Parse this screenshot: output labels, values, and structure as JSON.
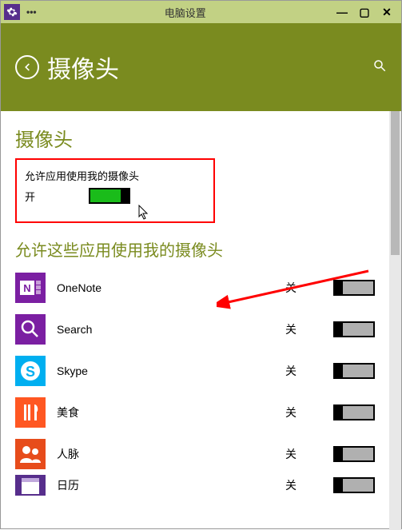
{
  "titlebar": {
    "title": "电脑设置"
  },
  "header": {
    "title": "摄像头"
  },
  "section1": {
    "title": "摄像头",
    "allow_label": "允许应用使用我的摄像头",
    "state": "开"
  },
  "section2": {
    "title": "允许这些应用使用我的摄像头"
  },
  "apps": [
    {
      "name": "OneNote",
      "state": "关",
      "color": "#7b1fa2"
    },
    {
      "name": "Search",
      "state": "关",
      "color": "#7b1fa2"
    },
    {
      "name": "Skype",
      "state": "关",
      "color": "#00aff0"
    },
    {
      "name": "美食",
      "state": "关",
      "color": "#ff5722"
    },
    {
      "name": "人脉",
      "state": "关",
      "color": "#e74c1b"
    },
    {
      "name": "日历",
      "state": "关",
      "color": "#572e8c"
    }
  ]
}
